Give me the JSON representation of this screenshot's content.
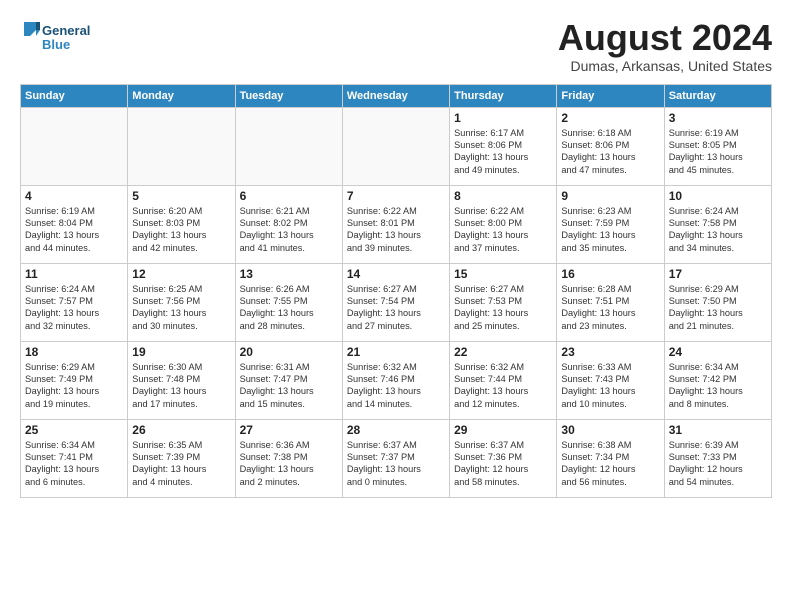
{
  "logo": {
    "line1": "General",
    "line2": "Blue"
  },
  "title": "August 2024",
  "location": "Dumas, Arkansas, United States",
  "weekdays": [
    "Sunday",
    "Monday",
    "Tuesday",
    "Wednesday",
    "Thursday",
    "Friday",
    "Saturday"
  ],
  "weeks": [
    [
      {
        "day": "",
        "info": ""
      },
      {
        "day": "",
        "info": ""
      },
      {
        "day": "",
        "info": ""
      },
      {
        "day": "",
        "info": ""
      },
      {
        "day": "1",
        "info": "Sunrise: 6:17 AM\nSunset: 8:06 PM\nDaylight: 13 hours\nand 49 minutes."
      },
      {
        "day": "2",
        "info": "Sunrise: 6:18 AM\nSunset: 8:06 PM\nDaylight: 13 hours\nand 47 minutes."
      },
      {
        "day": "3",
        "info": "Sunrise: 6:19 AM\nSunset: 8:05 PM\nDaylight: 13 hours\nand 45 minutes."
      }
    ],
    [
      {
        "day": "4",
        "info": "Sunrise: 6:19 AM\nSunset: 8:04 PM\nDaylight: 13 hours\nand 44 minutes."
      },
      {
        "day": "5",
        "info": "Sunrise: 6:20 AM\nSunset: 8:03 PM\nDaylight: 13 hours\nand 42 minutes."
      },
      {
        "day": "6",
        "info": "Sunrise: 6:21 AM\nSunset: 8:02 PM\nDaylight: 13 hours\nand 41 minutes."
      },
      {
        "day": "7",
        "info": "Sunrise: 6:22 AM\nSunset: 8:01 PM\nDaylight: 13 hours\nand 39 minutes."
      },
      {
        "day": "8",
        "info": "Sunrise: 6:22 AM\nSunset: 8:00 PM\nDaylight: 13 hours\nand 37 minutes."
      },
      {
        "day": "9",
        "info": "Sunrise: 6:23 AM\nSunset: 7:59 PM\nDaylight: 13 hours\nand 35 minutes."
      },
      {
        "day": "10",
        "info": "Sunrise: 6:24 AM\nSunset: 7:58 PM\nDaylight: 13 hours\nand 34 minutes."
      }
    ],
    [
      {
        "day": "11",
        "info": "Sunrise: 6:24 AM\nSunset: 7:57 PM\nDaylight: 13 hours\nand 32 minutes."
      },
      {
        "day": "12",
        "info": "Sunrise: 6:25 AM\nSunset: 7:56 PM\nDaylight: 13 hours\nand 30 minutes."
      },
      {
        "day": "13",
        "info": "Sunrise: 6:26 AM\nSunset: 7:55 PM\nDaylight: 13 hours\nand 28 minutes."
      },
      {
        "day": "14",
        "info": "Sunrise: 6:27 AM\nSunset: 7:54 PM\nDaylight: 13 hours\nand 27 minutes."
      },
      {
        "day": "15",
        "info": "Sunrise: 6:27 AM\nSunset: 7:53 PM\nDaylight: 13 hours\nand 25 minutes."
      },
      {
        "day": "16",
        "info": "Sunrise: 6:28 AM\nSunset: 7:51 PM\nDaylight: 13 hours\nand 23 minutes."
      },
      {
        "day": "17",
        "info": "Sunrise: 6:29 AM\nSunset: 7:50 PM\nDaylight: 13 hours\nand 21 minutes."
      }
    ],
    [
      {
        "day": "18",
        "info": "Sunrise: 6:29 AM\nSunset: 7:49 PM\nDaylight: 13 hours\nand 19 minutes."
      },
      {
        "day": "19",
        "info": "Sunrise: 6:30 AM\nSunset: 7:48 PM\nDaylight: 13 hours\nand 17 minutes."
      },
      {
        "day": "20",
        "info": "Sunrise: 6:31 AM\nSunset: 7:47 PM\nDaylight: 13 hours\nand 15 minutes."
      },
      {
        "day": "21",
        "info": "Sunrise: 6:32 AM\nSunset: 7:46 PM\nDaylight: 13 hours\nand 14 minutes."
      },
      {
        "day": "22",
        "info": "Sunrise: 6:32 AM\nSunset: 7:44 PM\nDaylight: 13 hours\nand 12 minutes."
      },
      {
        "day": "23",
        "info": "Sunrise: 6:33 AM\nSunset: 7:43 PM\nDaylight: 13 hours\nand 10 minutes."
      },
      {
        "day": "24",
        "info": "Sunrise: 6:34 AM\nSunset: 7:42 PM\nDaylight: 13 hours\nand 8 minutes."
      }
    ],
    [
      {
        "day": "25",
        "info": "Sunrise: 6:34 AM\nSunset: 7:41 PM\nDaylight: 13 hours\nand 6 minutes."
      },
      {
        "day": "26",
        "info": "Sunrise: 6:35 AM\nSunset: 7:39 PM\nDaylight: 13 hours\nand 4 minutes."
      },
      {
        "day": "27",
        "info": "Sunrise: 6:36 AM\nSunset: 7:38 PM\nDaylight: 13 hours\nand 2 minutes."
      },
      {
        "day": "28",
        "info": "Sunrise: 6:37 AM\nSunset: 7:37 PM\nDaylight: 13 hours\nand 0 minutes."
      },
      {
        "day": "29",
        "info": "Sunrise: 6:37 AM\nSunset: 7:36 PM\nDaylight: 12 hours\nand 58 minutes."
      },
      {
        "day": "30",
        "info": "Sunrise: 6:38 AM\nSunset: 7:34 PM\nDaylight: 12 hours\nand 56 minutes."
      },
      {
        "day": "31",
        "info": "Sunrise: 6:39 AM\nSunset: 7:33 PM\nDaylight: 12 hours\nand 54 minutes."
      }
    ]
  ]
}
